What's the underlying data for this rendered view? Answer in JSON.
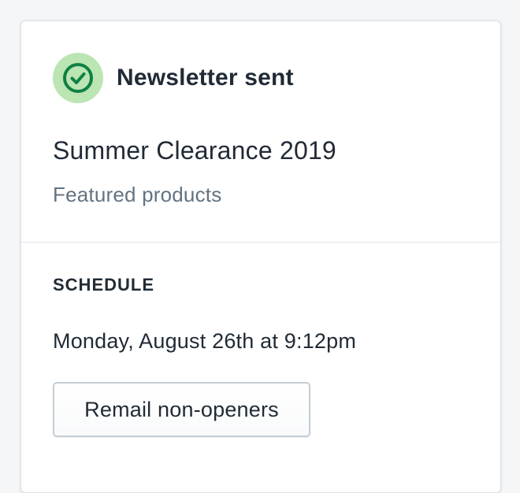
{
  "status": {
    "title": "Newsletter sent",
    "icon": "check-circle-icon",
    "icon_color": "#108043",
    "icon_bg_color": "#bbe5b3"
  },
  "campaign": {
    "name": "Summer Clearance 2019",
    "type": "Featured products"
  },
  "schedule": {
    "heading": "SCHEDULE",
    "date": "Monday, August 26th at 9:12pm"
  },
  "actions": {
    "remail_label": "Remail non-openers"
  }
}
